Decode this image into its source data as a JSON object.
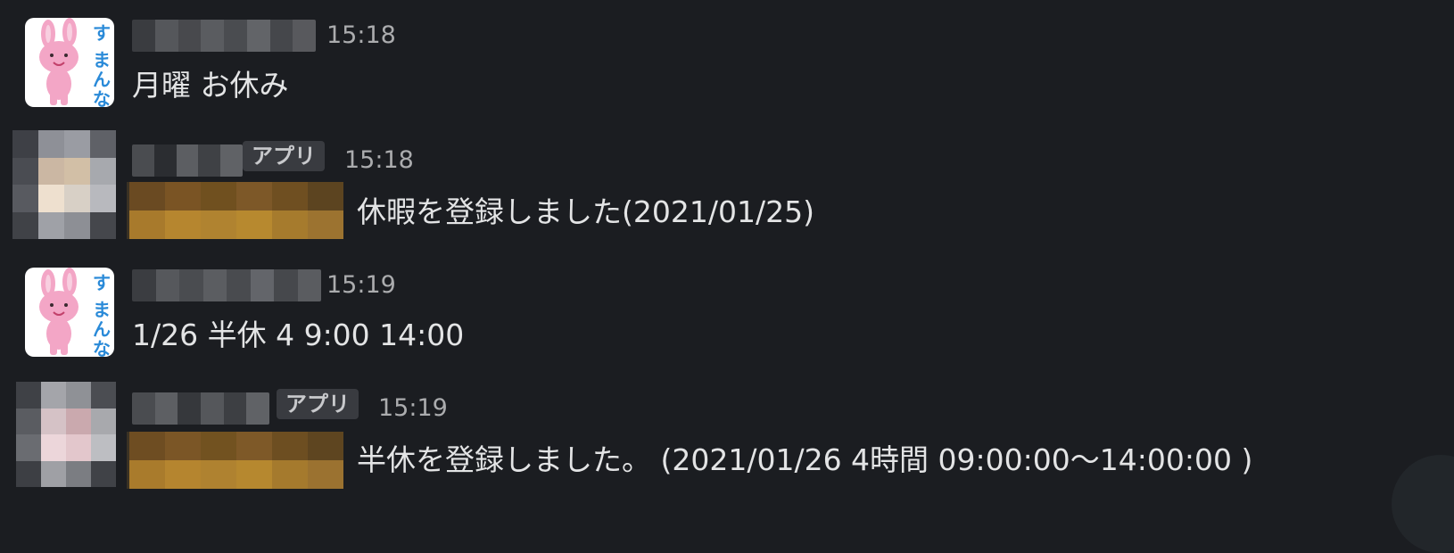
{
  "messages": [
    {
      "avatar": "rabbit-avatar",
      "avatar_text": "すまんな",
      "time": "15:18",
      "text": "月曜 お休み"
    },
    {
      "avatar": "blurred-avatar",
      "badge": "アプリ",
      "time": "15:18",
      "text": "休暇を登録しました(2021/01/25)"
    },
    {
      "avatar": "rabbit-avatar",
      "avatar_text": "すまんな",
      "time": "15:19",
      "text": "1/26 半休 4 9:00 14:00"
    },
    {
      "avatar": "blurred-avatar",
      "badge": "アプリ",
      "time": "15:19",
      "text": "半休を登録しました。 (2021/01/26 4時間 09:00:00〜14:00:00 )"
    }
  ],
  "colors": {
    "background": "#1b1d21",
    "text": "#e3e4e5",
    "timestamp": "#abacae",
    "badge_bg": "#393b40",
    "rabbit_pink": "#f3a6c6",
    "rabbit_text_blue": "#2a8ad8"
  }
}
